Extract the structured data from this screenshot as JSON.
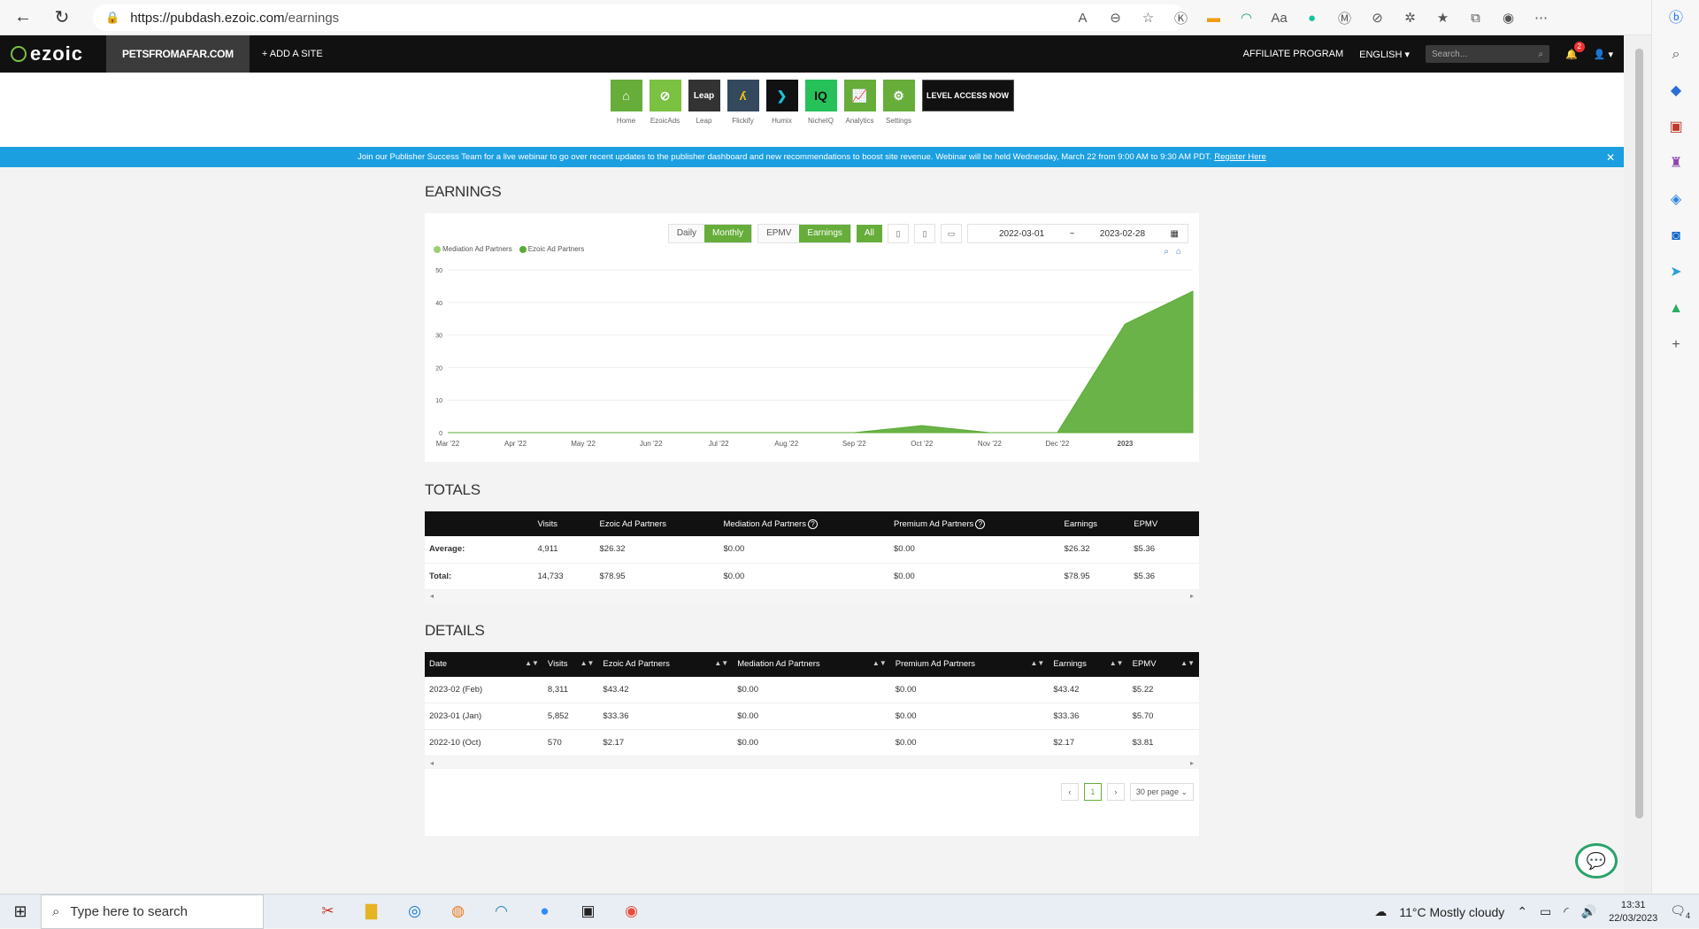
{
  "browser": {
    "url_host": "https://pubdash.ezoic.com",
    "url_path": "/earnings"
  },
  "topnav": {
    "logo": "ezoic",
    "site": "PETSFROMAFAR.COM",
    "add_site": "+ ADD A SITE",
    "affiliate": "AFFILIATE PROGRAM",
    "language": "ENGLISH ▾",
    "search_placeholder": "Search...",
    "notifications": "2"
  },
  "apps": [
    {
      "label": "Home",
      "color": "#66ad3a"
    },
    {
      "label": "EzoicAds",
      "color": "#7bc142"
    },
    {
      "label": "Leap",
      "color": "#333333"
    },
    {
      "label": "Flickify",
      "color": "#34495e"
    },
    {
      "label": "Humix",
      "color": "#111111"
    },
    {
      "label": "NicheIQ",
      "color": "#27c15a"
    },
    {
      "label": "Analytics",
      "color": "#66ad3a"
    },
    {
      "label": "Settings",
      "color": "#66ad3a"
    }
  ],
  "level_access": "LEVEL ACCESS NOW",
  "banner": {
    "text": "Join our Publisher Success Team for a live webinar to go over recent updates to the publisher dashboard and new recommendations to boost site revenue. Webinar will be held Wednesday, March 22 from 9:00 AM to 9:30 AM PDT.",
    "link": "Register Here"
  },
  "earnings": {
    "heading": "EARNINGS",
    "period_tabs": [
      "Daily",
      "Monthly"
    ],
    "metric_tabs": [
      "EPMV",
      "Earnings"
    ],
    "device_all": "All",
    "date_from": "2022-03-01",
    "date_sep": "~",
    "date_to": "2023-02-28",
    "legend": [
      "Mediation Ad Partners",
      "Ezoic Ad Partners"
    ]
  },
  "chart_data": {
    "type": "area",
    "categories": [
      "Mar '22",
      "Apr '22",
      "May '22",
      "Jun '22",
      "Jul '22",
      "Aug '22",
      "Sep '22",
      "Oct '22",
      "Nov '22",
      "Dec '22",
      "2023",
      ""
    ],
    "y_ticks": [
      0,
      10,
      20,
      30,
      40,
      50
    ],
    "ylim": [
      0,
      50
    ],
    "series": [
      {
        "name": "Mediation Ad Partners",
        "color": "#9ccf73",
        "values": [
          0,
          0,
          0,
          0,
          0,
          0,
          0,
          0,
          0,
          0,
          0,
          0
        ]
      },
      {
        "name": "Ezoic Ad Partners",
        "color": "#5aab34",
        "values": [
          0,
          0,
          0,
          0,
          0,
          0,
          0,
          2.17,
          0,
          0,
          33.36,
          43.42
        ]
      }
    ]
  },
  "totals": {
    "heading": "TOTALS",
    "headers": [
      "",
      "Visits",
      "Ezoic Ad Partners",
      "Mediation Ad Partners",
      "Premium Ad Partners",
      "Earnings",
      "EPMV"
    ],
    "rows": [
      [
        "Average:",
        "4,911",
        "$26.32",
        "$0.00",
        "$0.00",
        "$26.32",
        "$5.36"
      ],
      [
        "Total:",
        "14,733",
        "$78.95",
        "$0.00",
        "$0.00",
        "$78.95",
        "$5.36"
      ]
    ]
  },
  "details": {
    "heading": "DETAILS",
    "headers": [
      "Date",
      "Visits",
      "Ezoic Ad Partners",
      "Mediation Ad Partners",
      "Premium Ad Partners",
      "Earnings",
      "EPMV"
    ],
    "rows": [
      [
        "2023-02 (Feb)",
        "8,311",
        "$43.42",
        "$0.00",
        "$0.00",
        "$43.42",
        "$5.22"
      ],
      [
        "2023-01 (Jan)",
        "5,852",
        "$33.36",
        "$0.00",
        "$0.00",
        "$33.36",
        "$5.70"
      ],
      [
        "2022-10 (Oct)",
        "570",
        "$2.17",
        "$0.00",
        "$0.00",
        "$2.17",
        "$3.81"
      ]
    ],
    "page": "1",
    "per_page": "30 per page ⌄"
  },
  "taskbar": {
    "search_placeholder": "Type here to search",
    "weather": "11°C  Mostly cloudy",
    "time": "13:31",
    "date": "22/03/2023",
    "notif_count": "4"
  }
}
